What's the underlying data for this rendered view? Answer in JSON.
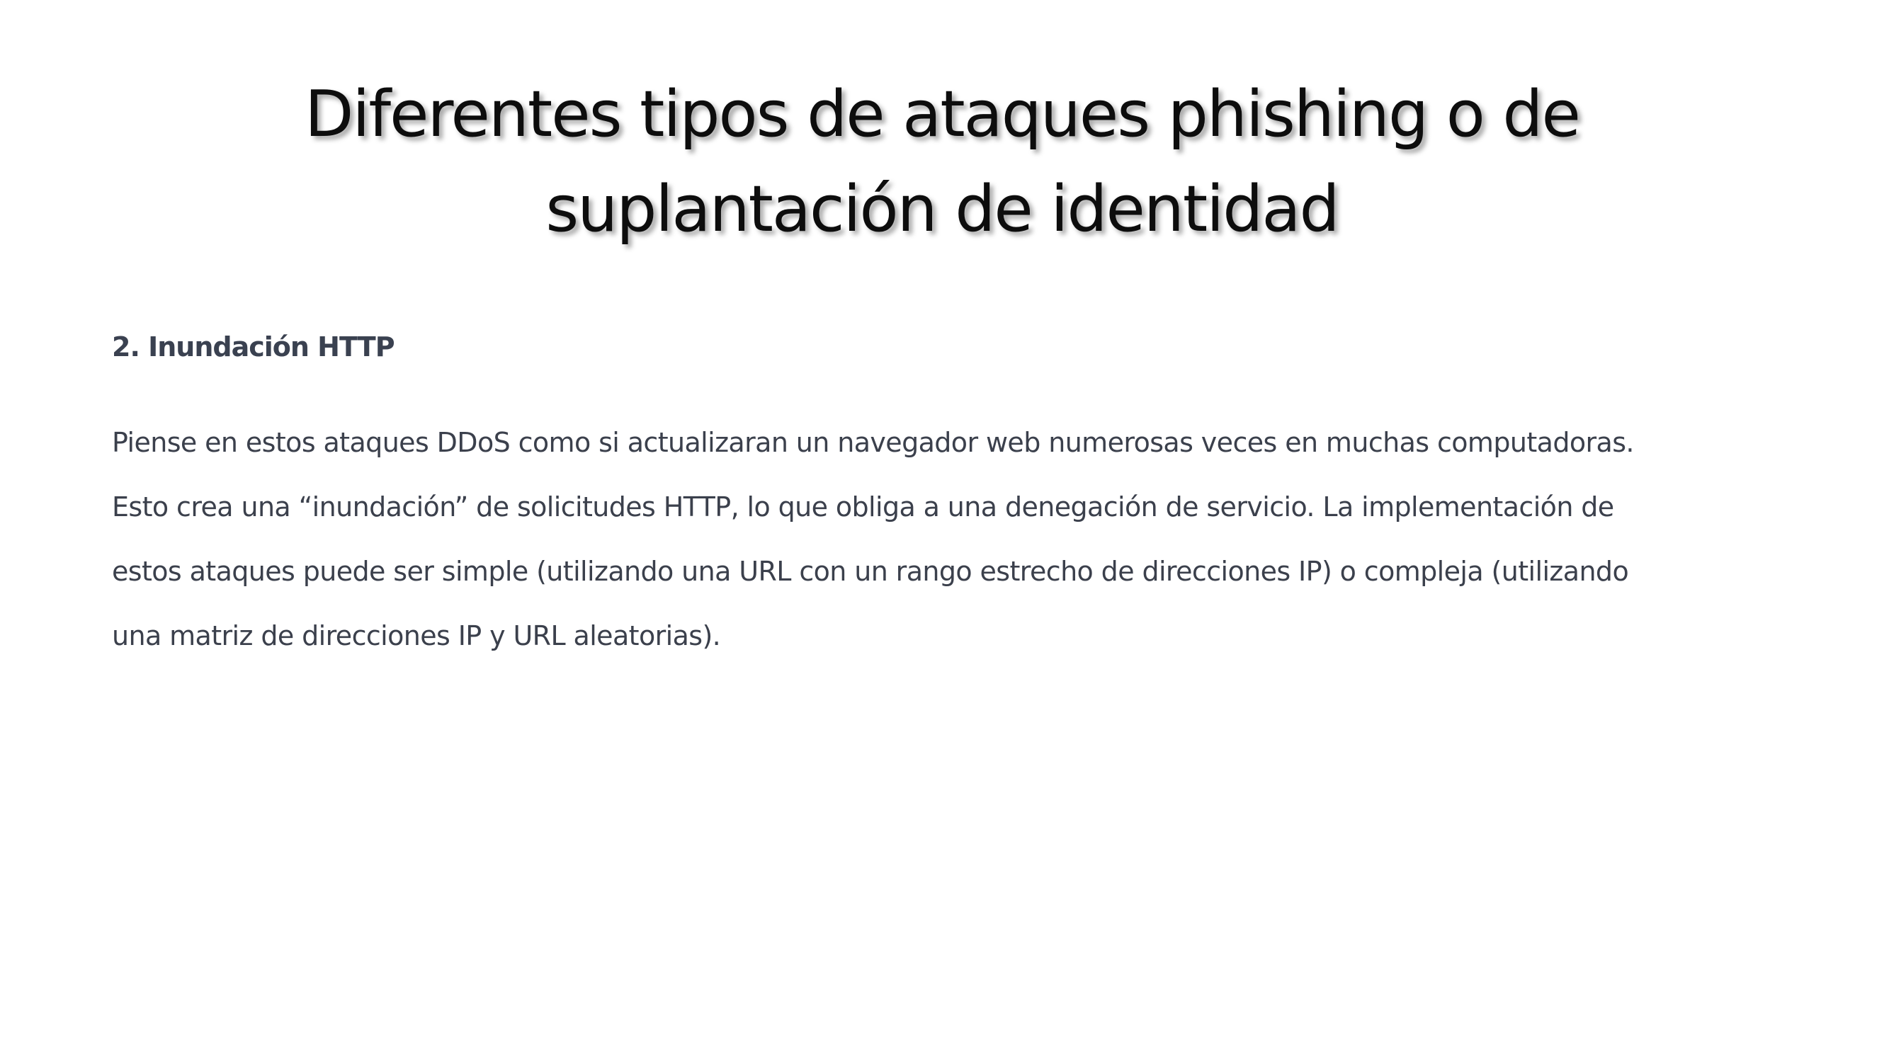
{
  "slide": {
    "title_lines": [
      "Diferentes tipos de ataques phishing o de",
      "suplantación de identidad"
    ],
    "subheading": "2. Inundación HTTP",
    "body_lines": [
      "Piense en estos ataques DDoS como si actualizaran un navegador web numerosas veces en muchas computadoras.",
      "Esto crea una “inundación” de solicitudes HTTP, lo que obliga a una denegación de servicio. La implementación de",
      "estos ataques puede ser simple (utilizando una URL con un rango estrecho de direcciones IP) o compleja (utilizando",
      "una matriz de direcciones IP y URL aleatorias)."
    ]
  },
  "colors": {
    "background": "#ffffff",
    "title": "#0d0d0d",
    "text": "#3b404c"
  }
}
